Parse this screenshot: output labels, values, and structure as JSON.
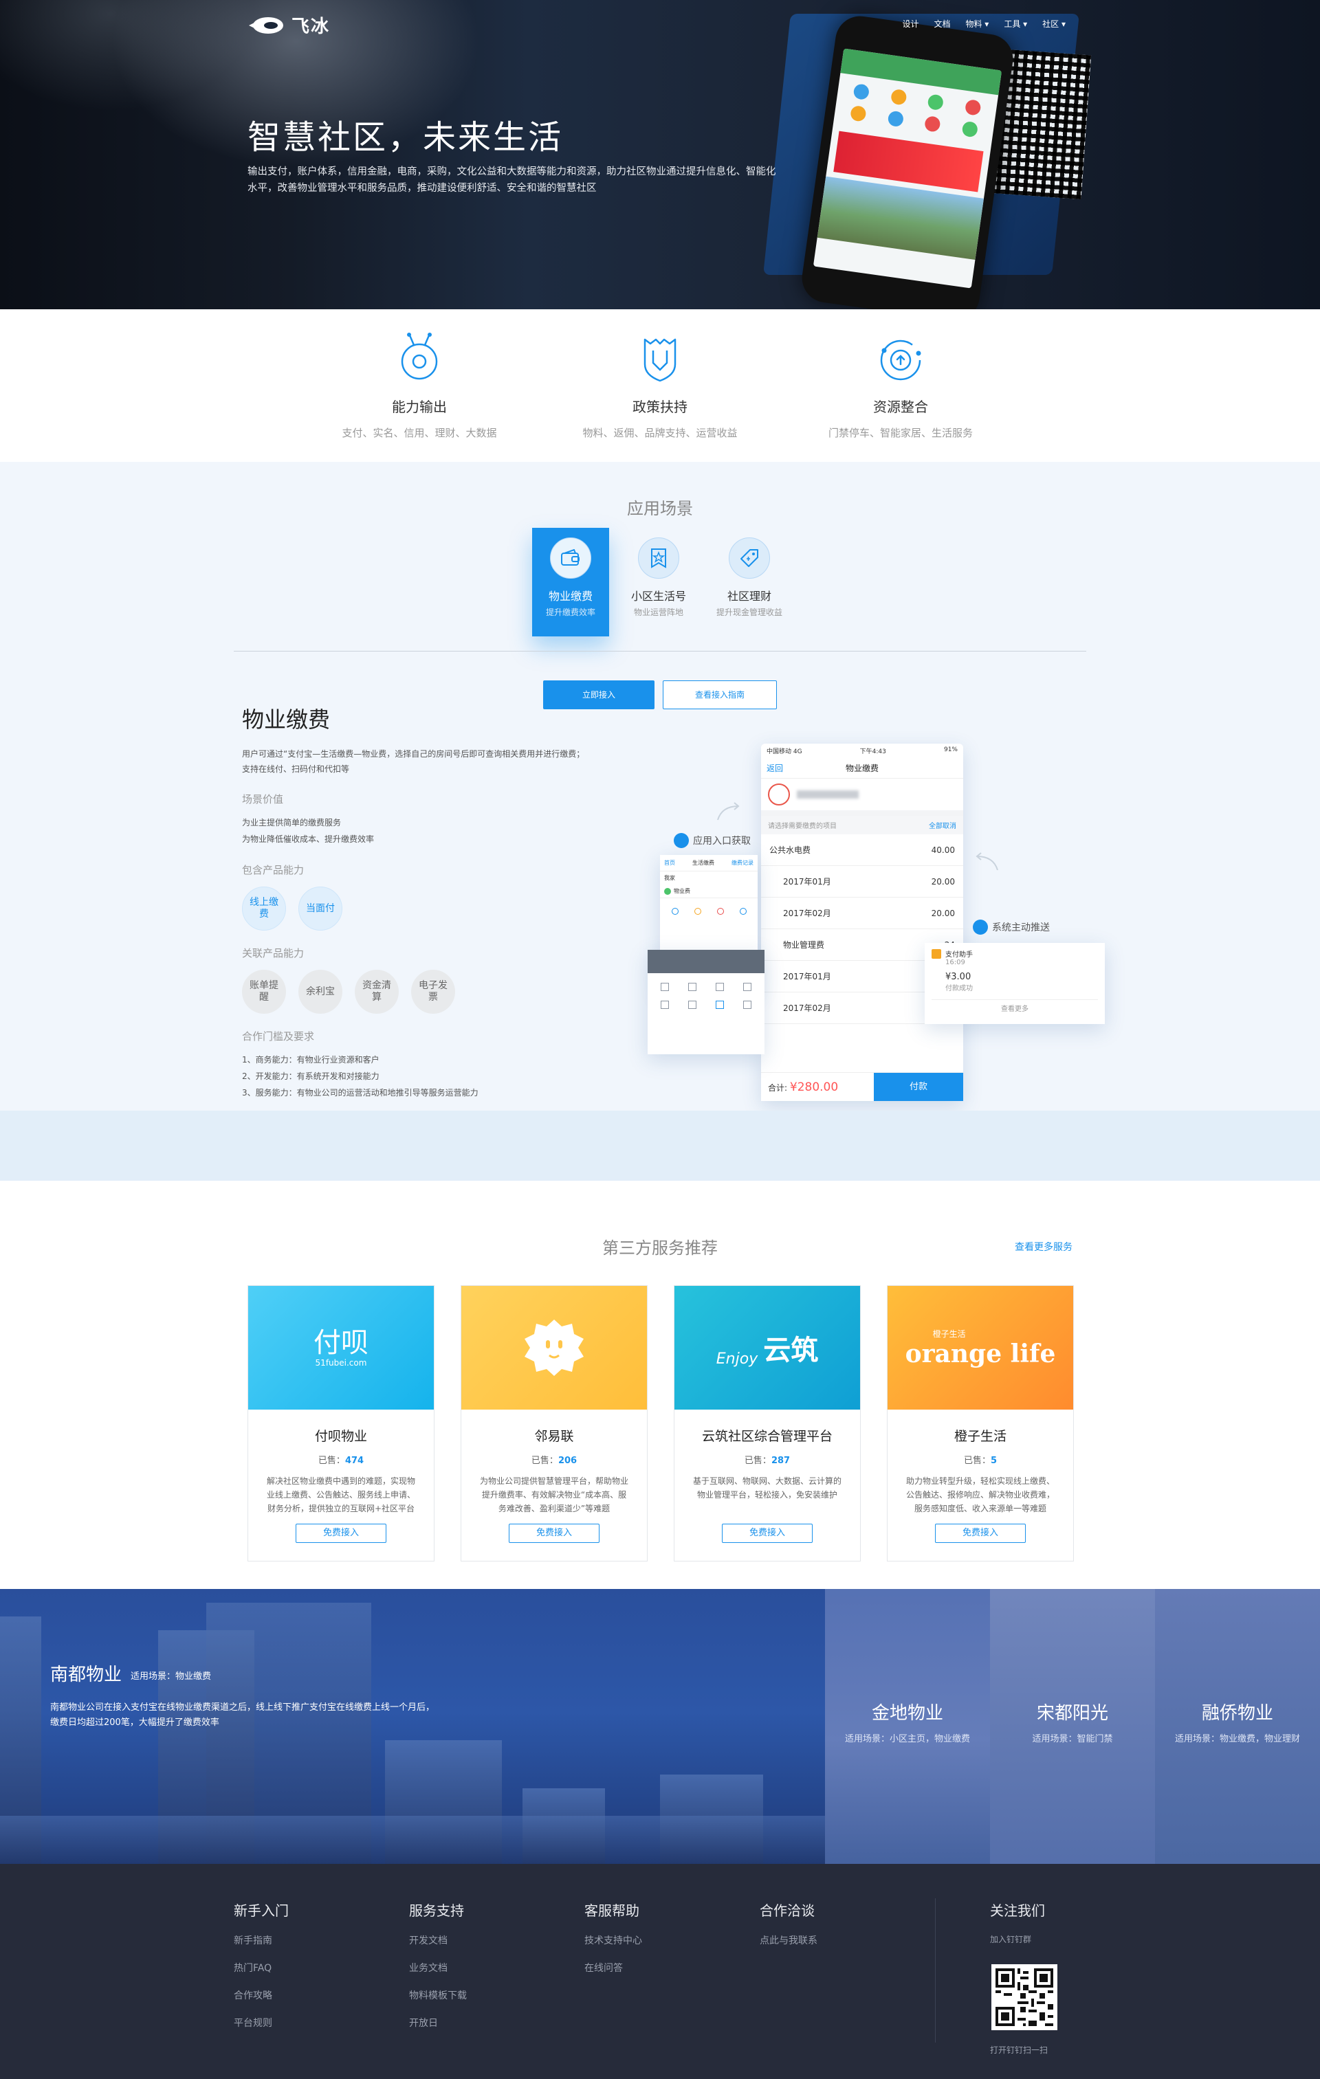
{
  "brand": {
    "name": "飞冰"
  },
  "nav": {
    "items": [
      "设计",
      "文档",
      "物料 ▾",
      "工具 ▾",
      "社区 ▾"
    ]
  },
  "hero": {
    "title": "智慧社区，未来生活",
    "desc": "输出支付，账户体系，信用金融，电商，采购，文化公益和大数据等能力和资源，助力社区物业通过提升信息化、智能化水平，改善物业管理水平和服务品质，推动建设便利舒适、安全和谐的智慧社区"
  },
  "features": [
    {
      "title": "能力输出",
      "sub": "支付、实名、信用、理财、大数据",
      "icon": "power-icon"
    },
    {
      "title": "政策扶持",
      "sub": "物料、返佣、品牌支持、运营收益",
      "icon": "shield-icon"
    },
    {
      "title": "资源整合",
      "sub": "门禁停车、智能家居、生活服务",
      "icon": "orbit-icon"
    }
  ],
  "scene": {
    "title": "应用场景",
    "tabs": [
      {
        "label": "物业缴费",
        "desc": "提升缴费效率",
        "active": true
      },
      {
        "label": "小区生活号",
        "desc": "物业运营阵地",
        "active": false
      },
      {
        "label": "社区理财",
        "desc": "提升现金管理收益",
        "active": false
      }
    ],
    "detail": {
      "title": "物业缴费",
      "desc": "用户可通过“支付宝—生活缴费—物业费，选择自己的房间号后即可查询相关费用并进行缴费；支持在线付、扫码付和代扣等",
      "value_title": "场景价值",
      "values": [
        "为业主提供简单的缴费服务",
        "为物业降低催收成本、提升缴费效率"
      ],
      "product_title": "包含产品能力",
      "products": [
        "线上缴费",
        "当面付"
      ],
      "related_title": "关联产品能力",
      "related": [
        "账单提醒",
        "余利宝",
        "资金清算",
        "电子发票"
      ],
      "req_title": "合作门槛及要求",
      "reqs": [
        "1、商务能力：有物业行业资源和客户",
        "2、开发能力：有系统开发和对接能力",
        "3、服务能力：有物业公司的运营活动和地推引导等服务运营能力"
      ]
    },
    "mock": {
      "entry_label": "应用入口获取",
      "push_label": "系统主动推送",
      "carrier": "中国移动 4G",
      "time": "下午4:43",
      "battery": "91%",
      "back": "返回",
      "page_title": "物业缴费",
      "hint": "请选择需要缴费的项目",
      "cancel_all": "全部取消",
      "items": [
        {
          "name": "公共水电费",
          "amount": "40.00"
        },
        {
          "name": "2017年01月",
          "amount": "20.00"
        },
        {
          "name": "2017年02月",
          "amount": "20.00"
        },
        {
          "name": "物业管理费",
          "amount": "24"
        },
        {
          "name": "2017年01月",
          "amount": ""
        },
        {
          "name": "2017年02月",
          "amount": ""
        }
      ],
      "total_label": "合计:",
      "total": "¥280.00",
      "pay": "付款",
      "small_title": "生活缴费",
      "small_back": "首页",
      "small_records": "缴费记录",
      "small_home": "我家",
      "small_item": "物业费",
      "notify_app": "支付助手",
      "notify_time": "16:09",
      "notify_amount": "¥3.00",
      "notify_status": "付款成功",
      "notify_more": "查看更多"
    },
    "cta": {
      "primary": "立即接入",
      "secondary": "查看接入指南"
    }
  },
  "third": {
    "title": "第三方服务推荐",
    "more": "查看更多服务",
    "sold_label": "已售：",
    "go_label": "免费接入",
    "items": [
      {
        "name": "付呗物业",
        "sold": "474",
        "desc": "解决社区物业缴费中遇到的难题，实现物业线上缴费、公告触达、服务线上申请、财务分析，提供独立的互联网+社区平台",
        "logo": "付呗",
        "logo_sub": "51fubei.com",
        "color": "#2fbff0"
      },
      {
        "name": "邻易联",
        "sold": "206",
        "desc": "为物业公司提供智慧管理平台，帮助物业提升缴费率、有效解决物业“成本高、服务难改善、盈利渠道少”等难题",
        "logo": "",
        "logo_sub": "",
        "color": "#ffc64a"
      },
      {
        "name": "云筑社区综合管理平台",
        "sold": "287",
        "desc": "基于互联网、物联网、大数据、云计算的物业管理平台，轻松接入，免安装维护",
        "logo": "云筑",
        "logo_sub": "Enjoy",
        "color": "#1fb1d8"
      },
      {
        "name": "橙子生活",
        "sold": "5",
        "desc": "助力物业转型升级，轻松实现线上缴费、公告触达、报修响应、解决物业收费难，服务感知度低、收入来源单一等难题",
        "logo": "orange life",
        "logo_sub": "橙子生活",
        "color": "#ff9a2e"
      }
    ]
  },
  "cases": {
    "main": {
      "name": "南都物业",
      "scene": "适用场景：物业缴费",
      "desc": "南都物业公司在接入支付宝在线物业缴费渠道之后，线上线下推广支付宝在线缴费上线一个月后，缴费日均超过200笔，大幅提升了缴费效率"
    },
    "side": [
      {
        "name": "金地物业",
        "scene": "适用场景：小区主页，物业缴费"
      },
      {
        "name": "宋都阳光",
        "scene": "适用场景：智能门禁"
      },
      {
        "name": "融侨物业",
        "scene": "适用场景：物业缴费，物业理财"
      }
    ]
  },
  "footer": {
    "cols": [
      {
        "title": "新手入门",
        "items": [
          "新手指南",
          "热门FAQ",
          "合作攻略",
          "平台规则"
        ]
      },
      {
        "title": "服务支持",
        "items": [
          "开发文档",
          "业务文档",
          "物料模板下载",
          "开放日"
        ]
      },
      {
        "title": "客服帮助",
        "items": [
          "技术支持中心",
          "在线问答"
        ]
      },
      {
        "title": "合作洽谈",
        "items": [
          "点此与我联系"
        ]
      }
    ],
    "follow": {
      "title": "关注我们",
      "join": "加入钉钉群",
      "scan": "打开钉钉扫一扫"
    }
  },
  "colors": {
    "accent": "#1991eb",
    "footer": "#262b3a",
    "scene_bg": "#f1f6fc"
  }
}
